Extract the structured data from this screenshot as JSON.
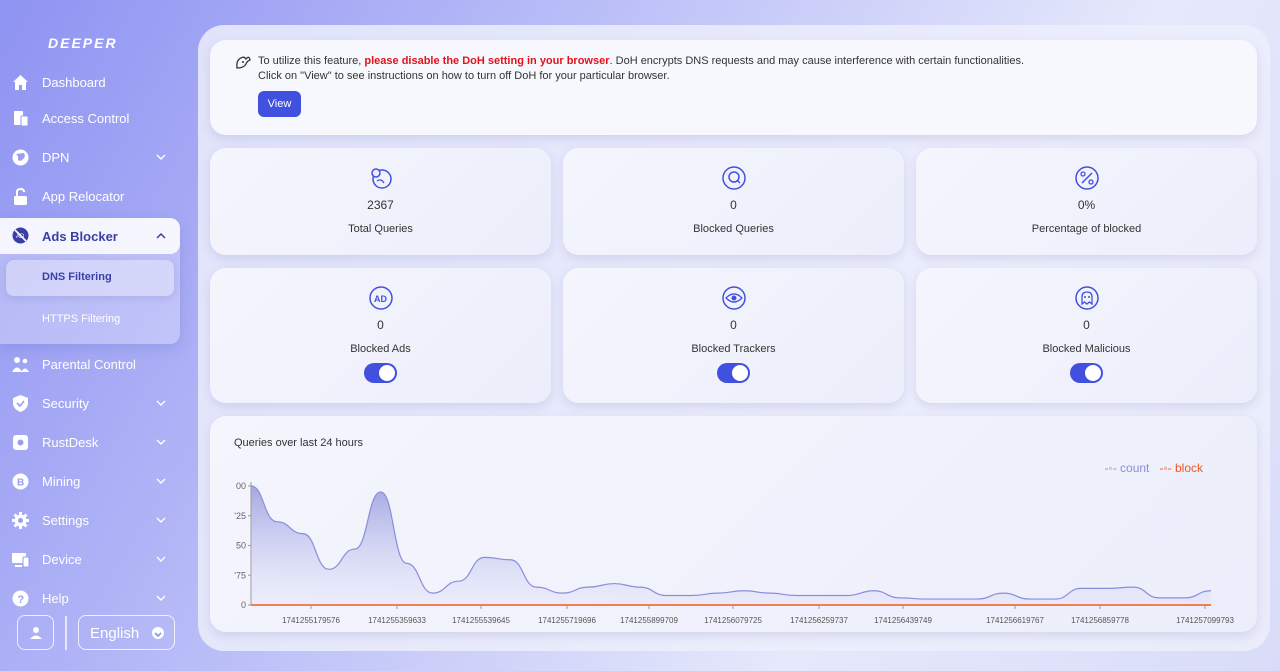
{
  "brand": {
    "logo_text": "DEEPER",
    "accent": "#4250e0"
  },
  "sidebar": {
    "items": [
      {
        "key": "dashboard",
        "label": "Dashboard",
        "icon": "home-icon",
        "has_chevron": false
      },
      {
        "key": "access-control",
        "label": "Access Control",
        "icon": "access-card-icon",
        "has_chevron": false
      },
      {
        "key": "dpn",
        "label": "DPN",
        "icon": "globe-icon",
        "has_chevron": true
      },
      {
        "key": "app-relocator",
        "label": "App Relocator",
        "icon": "unlock-icon",
        "has_chevron": false
      },
      {
        "key": "ads-blocker",
        "label": "Ads Blocker",
        "icon": "no-ads-icon",
        "has_chevron": true,
        "expanded": true
      },
      {
        "key": "parental-control",
        "label": "Parental Control",
        "icon": "family-icon",
        "has_chevron": false
      },
      {
        "key": "security",
        "label": "Security",
        "icon": "shield-icon",
        "has_chevron": true
      },
      {
        "key": "rustdesk",
        "label": "RustDesk",
        "icon": "rustdesk-icon",
        "has_chevron": true
      },
      {
        "key": "mining",
        "label": "Mining",
        "icon": "coin-icon",
        "has_chevron": true
      },
      {
        "key": "settings",
        "label": "Settings",
        "icon": "gear-icon",
        "has_chevron": true
      },
      {
        "key": "device",
        "label": "Device",
        "icon": "monitor-icon",
        "has_chevron": true
      },
      {
        "key": "help",
        "label": "Help",
        "icon": "question-icon",
        "has_chevron": true
      }
    ],
    "ads_sub": [
      {
        "label": "DNS Filtering",
        "active": true
      },
      {
        "label": "HTTPS Filtering",
        "active": false
      }
    ],
    "language": "English"
  },
  "notice": {
    "line1_pre": "To utilize this feature, ",
    "line1_warn": "please disable the DoH setting in your browser",
    "line1_post": ". DoH encrypts DNS requests and may cause interference with certain functionalities.",
    "line2": "Click on \"View\" to see instructions on how to turn off DoH for your particular browser.",
    "view_label": "View"
  },
  "stats": [
    {
      "value": "2367",
      "label": "Total Queries",
      "icon": "globe-search-icon"
    },
    {
      "value": "0",
      "label": "Blocked Queries",
      "icon": "blocked-search-icon"
    },
    {
      "value": "0%",
      "label": "Percentage of blocked",
      "icon": "percent-icon"
    },
    {
      "value": "0",
      "label": "Blocked Ads",
      "icon": "ad-icon",
      "toggle": true
    },
    {
      "value": "0",
      "label": "Blocked Trackers",
      "icon": "eye-icon",
      "toggle": true
    },
    {
      "value": "0",
      "label": "Blocked Malicious",
      "icon": "ghost-icon",
      "toggle": true
    }
  ],
  "chart_data": {
    "type": "area",
    "title": "Queries over last 24 hours",
    "legend_position": "top-right",
    "series": [
      {
        "name": "count",
        "color": "#8a8ed8",
        "values": [
          100,
          70,
          60,
          30,
          47,
          95,
          35,
          10,
          20,
          40,
          38,
          15,
          10,
          15,
          18,
          15,
          8,
          8,
          10,
          12,
          10,
          8,
          8,
          8,
          12,
          6,
          5,
          5,
          5,
          10,
          5,
          5,
          14,
          14,
          15,
          6,
          6,
          12
        ]
      },
      {
        "name": "block",
        "color": "#f25a1a",
        "values": [
          0,
          0,
          0,
          0,
          0,
          0,
          0,
          0,
          0,
          0,
          0,
          0,
          0,
          0,
          0,
          0,
          0,
          0,
          0,
          0,
          0,
          0,
          0,
          0,
          0,
          0,
          0,
          0,
          0,
          0,
          0,
          0,
          0,
          0,
          0,
          0,
          0,
          0
        ]
      }
    ],
    "ylim": [
      0,
      100
    ],
    "ytick_labels": [
      "0",
      "'75",
      "50",
      "'25",
      "00"
    ],
    "xtick_labels": [
      "1741255179576",
      "1741255359633",
      "1741255539645",
      "1741255719696",
      "1741255899709",
      "1741256079725",
      "1741256259737",
      "1741256439749",
      "1741256619767",
      "1741256859778",
      "1741257099793"
    ]
  }
}
